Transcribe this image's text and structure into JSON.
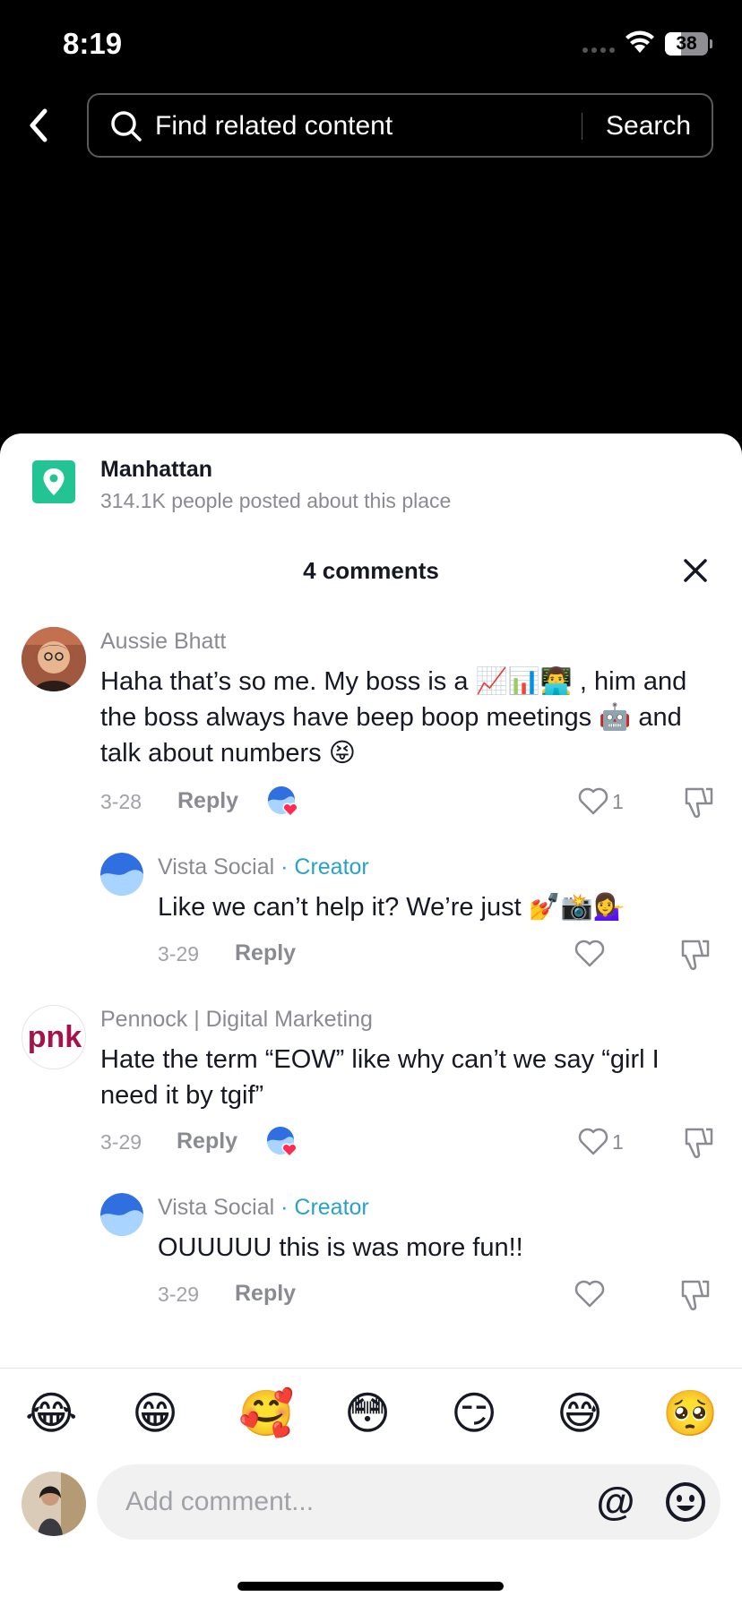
{
  "status": {
    "time": "8:19",
    "battery": "38",
    "battery_level": 0.38
  },
  "search": {
    "placeholder": "Find related content",
    "button": "Search"
  },
  "place": {
    "name": "Manhattan",
    "subtitle": "314.1K people posted about this place",
    "icon": "location-pin-icon",
    "color": "#22c493"
  },
  "comments_header": {
    "title": "4 comments"
  },
  "comments": [
    {
      "user": "Aussie Bhatt",
      "text": "Haha that’s so me. My boss is a 📈📊👨‍💻 , him and the boss always have beep boop meetings 🤖 and talk about numbers 😝",
      "date": "3-28",
      "reply": "Reply",
      "likes": "1",
      "liked_by_creator": true,
      "replies": [
        {
          "user": "Vista Social",
          "badge": "· Creator",
          "text": "Like we can’t help it? We’re just 💅📸💁‍♀️",
          "date": "3-29",
          "reply": "Reply"
        }
      ]
    },
    {
      "user": "Pennock | Digital Marketing",
      "avatar_text": "pnk",
      "text": "Hate the term “EOW” like why can’t we say “girl I need it by tgif”",
      "date": "3-29",
      "reply": "Reply",
      "likes": "1",
      "liked_by_creator": true,
      "replies": [
        {
          "user": "Vista Social",
          "badge": "· Creator",
          "text": "OUUUUU this is was more fun!!",
          "date": "3-29",
          "reply": "Reply"
        }
      ]
    }
  ],
  "emoji_bar": [
    "😂",
    "😁",
    "🥰",
    "😳",
    "😏",
    "😅",
    "🥺"
  ],
  "input": {
    "placeholder": "Add comment..."
  },
  "colors": {
    "accent_creator": "#2aa2c7",
    "like_red": "#fe2c55"
  }
}
